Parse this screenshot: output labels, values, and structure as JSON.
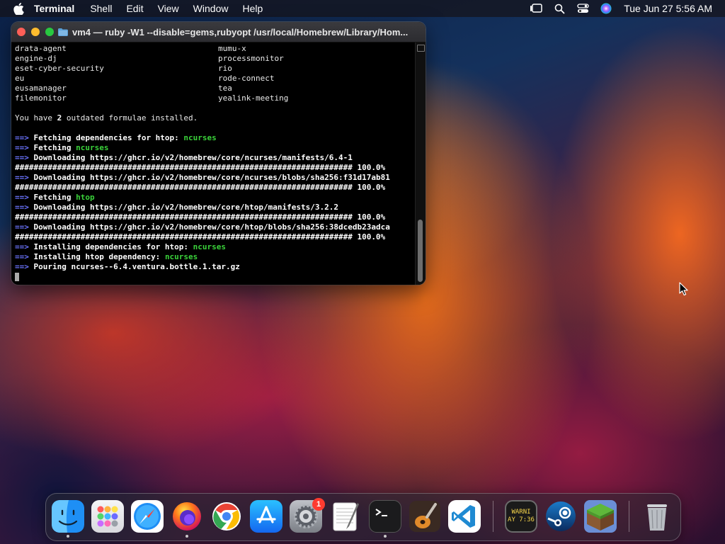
{
  "menubar": {
    "app_name": "Terminal",
    "items": [
      "Shell",
      "Edit",
      "View",
      "Window",
      "Help"
    ],
    "clock": "Tue Jun 27  5:56 AM"
  },
  "terminal": {
    "title": "vm4 — ruby -W1 --disable=gems,rubyopt /usr/local/Homebrew/Library/Hom...",
    "cask_list": [
      [
        "drata-agent",
        "mumu-x"
      ],
      [
        "engine-dj",
        "processmonitor"
      ],
      [
        "eset-cyber-security",
        "rio"
      ],
      [
        "eu",
        "rode-connect"
      ],
      [
        "eusamanager",
        "tea"
      ],
      [
        "filemonitor",
        "yealink-meeting"
      ]
    ],
    "outdated": {
      "prefix": "You have ",
      "count": "2",
      "suffix": " outdated formulae installed."
    },
    "arrow": "==>",
    "progress_bar": "######################################################################## 100.0%",
    "lines": [
      {
        "kind": "step",
        "text": "Fetching dependencies for htop: ",
        "pkg": "ncurses"
      },
      {
        "kind": "step",
        "text": "Fetching ",
        "pkg": "ncurses"
      },
      {
        "kind": "step",
        "text": "Downloading https://ghcr.io/v2/homebrew/core/ncurses/manifests/6.4-1",
        "pkg": ""
      },
      {
        "kind": "bar"
      },
      {
        "kind": "step",
        "text": "Downloading https://ghcr.io/v2/homebrew/core/ncurses/blobs/sha256:f31d17ab81",
        "pkg": ""
      },
      {
        "kind": "bar"
      },
      {
        "kind": "step",
        "text": "Fetching ",
        "pkg": "htop"
      },
      {
        "kind": "step",
        "text": "Downloading https://ghcr.io/v2/homebrew/core/htop/manifests/3.2.2",
        "pkg": ""
      },
      {
        "kind": "bar"
      },
      {
        "kind": "step",
        "text": "Downloading https://ghcr.io/v2/homebrew/core/htop/blobs/sha256:38dcedb23adca",
        "pkg": ""
      },
      {
        "kind": "bar"
      },
      {
        "kind": "step",
        "text": "Installing dependencies for htop: ",
        "pkg": "ncurses"
      },
      {
        "kind": "step",
        "text": "Installing htop dependency: ",
        "pkg": "ncurses"
      },
      {
        "kind": "step",
        "text": "Pouring ncurses--6.4.ventura.bottle.1.tar.gz",
        "pkg": ""
      }
    ]
  },
  "dock": {
    "settings_badge": "1",
    "warning_widget": [
      "WARNI",
      "AY 7:36"
    ],
    "apps": [
      {
        "name": "finder",
        "running": true
      },
      {
        "name": "launchpad",
        "running": false
      },
      {
        "name": "safari",
        "running": false
      },
      {
        "name": "firefox",
        "running": true
      },
      {
        "name": "chrome",
        "running": false
      },
      {
        "name": "app-store",
        "running": false
      },
      {
        "name": "system-settings",
        "running": false
      },
      {
        "name": "textedit",
        "running": false
      },
      {
        "name": "terminal",
        "running": true
      },
      {
        "name": "garageband",
        "running": false
      },
      {
        "name": "vscode",
        "running": false
      },
      {
        "name": "console",
        "running": false
      },
      {
        "name": "steam",
        "running": false
      },
      {
        "name": "minecraft",
        "running": false
      },
      {
        "name": "trash",
        "running": false
      }
    ]
  },
  "colors": {
    "arrow": "#6b74ff",
    "package": "#3ad23a",
    "close": "#fe5f57",
    "minimize": "#febc2e",
    "maximize": "#28c840"
  }
}
